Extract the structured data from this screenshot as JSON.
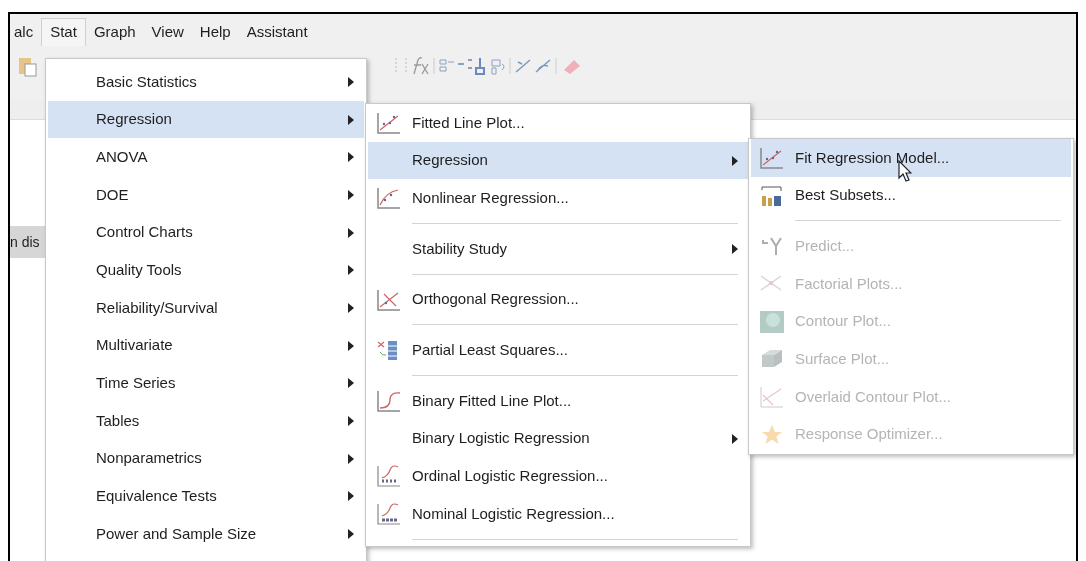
{
  "menubar": [
    {
      "label": "alc",
      "selected": false
    },
    {
      "label": "Stat",
      "selected": true
    },
    {
      "label": "Graph",
      "selected": false
    },
    {
      "label": "View",
      "selected": false
    },
    {
      "label": "Help",
      "selected": false
    },
    {
      "label": "Assistant",
      "selected": false
    }
  ],
  "side_tab": {
    "label": "n dis"
  },
  "stat_menu": [
    {
      "label": "Basic Statistics",
      "selected": false,
      "has_submenu": true
    },
    {
      "label": "Regression",
      "selected": true,
      "has_submenu": true
    },
    {
      "label": "ANOVA",
      "selected": false,
      "has_submenu": true
    },
    {
      "label": "DOE",
      "selected": false,
      "has_submenu": true
    },
    {
      "label": "Control Charts",
      "selected": false,
      "has_submenu": true
    },
    {
      "label": "Quality Tools",
      "selected": false,
      "has_submenu": true
    },
    {
      "label": "Reliability/Survival",
      "selected": false,
      "has_submenu": true
    },
    {
      "label": "Multivariate",
      "selected": false,
      "has_submenu": true
    },
    {
      "label": "Time Series",
      "selected": false,
      "has_submenu": true
    },
    {
      "label": "Tables",
      "selected": false,
      "has_submenu": true
    },
    {
      "label": "Nonparametrics",
      "selected": false,
      "has_submenu": true
    },
    {
      "label": "Equivalence Tests",
      "selected": false,
      "has_submenu": true
    },
    {
      "label": "Power and Sample Size",
      "selected": false,
      "has_submenu": true
    }
  ],
  "regression_menu": [
    {
      "kind": "item",
      "label": "Fitted Line Plot...",
      "selected": false,
      "has_submenu": false
    },
    {
      "kind": "item",
      "label": "Regression",
      "selected": true,
      "has_submenu": true
    },
    {
      "kind": "item",
      "label": "Nonlinear Regression...",
      "selected": false,
      "has_submenu": false
    },
    {
      "kind": "separator"
    },
    {
      "kind": "item",
      "label": "Stability Study",
      "selected": false,
      "has_submenu": true
    },
    {
      "kind": "separator"
    },
    {
      "kind": "item",
      "label": "Orthogonal Regression...",
      "selected": false,
      "has_submenu": false
    },
    {
      "kind": "separator"
    },
    {
      "kind": "item",
      "label": "Partial Least Squares...",
      "selected": false,
      "has_submenu": false
    },
    {
      "kind": "separator"
    },
    {
      "kind": "item",
      "label": "Binary Fitted Line Plot...",
      "selected": false,
      "has_submenu": false
    },
    {
      "kind": "item",
      "label": "Binary Logistic Regression",
      "selected": false,
      "has_submenu": true
    },
    {
      "kind": "item",
      "label": "Ordinal Logistic Regression...",
      "selected": false,
      "has_submenu": false
    },
    {
      "kind": "item",
      "label": "Nominal Logistic Regression...",
      "selected": false,
      "has_submenu": false
    },
    {
      "kind": "separator"
    }
  ],
  "model_menu": [
    {
      "kind": "item",
      "label": "Fit Regression Model...",
      "selected": true,
      "disabled": false
    },
    {
      "kind": "item",
      "label": "Best Subsets...",
      "selected": false,
      "disabled": false
    },
    {
      "kind": "separator"
    },
    {
      "kind": "item",
      "label": "Predict...",
      "selected": false,
      "disabled": true
    },
    {
      "kind": "item",
      "label": "Factorial Plots...",
      "selected": false,
      "disabled": true
    },
    {
      "kind": "item",
      "label": "Contour Plot...",
      "selected": false,
      "disabled": true
    },
    {
      "kind": "item",
      "label": "Surface Plot...",
      "selected": false,
      "disabled": true
    },
    {
      "kind": "item",
      "label": "Overlaid Contour Plot...",
      "selected": false,
      "disabled": true
    },
    {
      "kind": "item",
      "label": "Response Optimizer...",
      "selected": false,
      "disabled": true
    }
  ]
}
